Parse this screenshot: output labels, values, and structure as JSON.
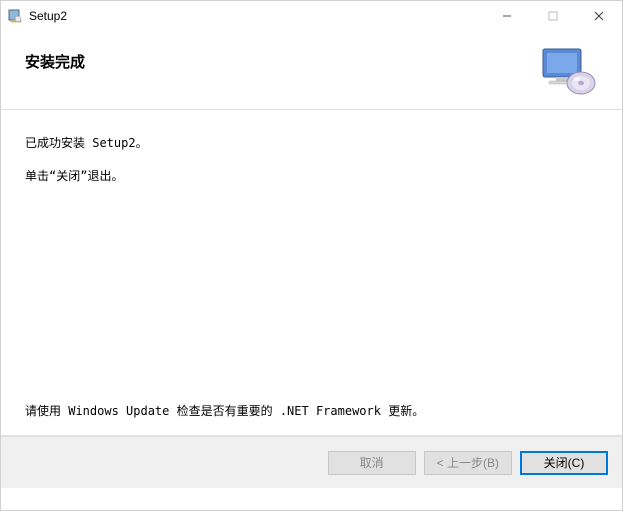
{
  "titlebar": {
    "title": "Setup2"
  },
  "header": {
    "title": "安装完成"
  },
  "body": {
    "line1": "已成功安装 Setup2。",
    "line2": "单击“关闭”退出。",
    "note": "请使用 Windows Update 检查是否有重要的 .NET Framework 更新。"
  },
  "footer": {
    "cancel": "取消",
    "back": "< 上一步(B)",
    "close": "关闭(C)"
  }
}
